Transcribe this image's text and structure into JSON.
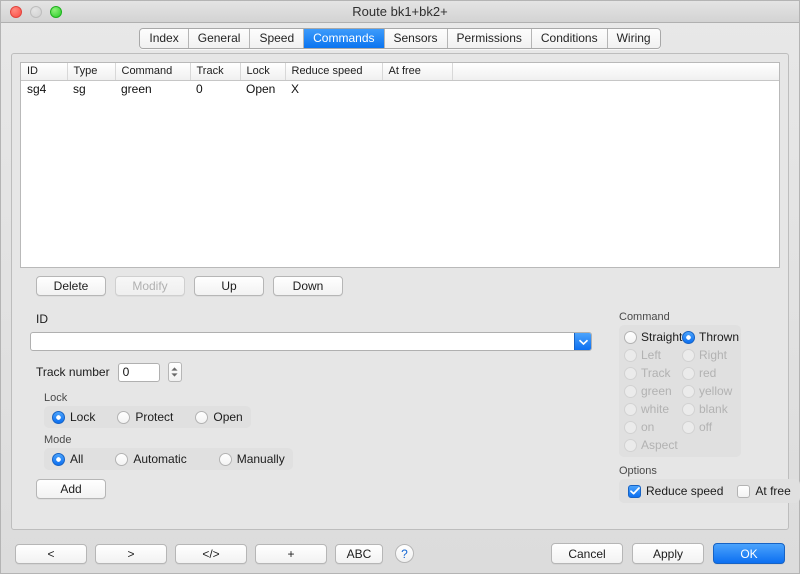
{
  "window": {
    "title": "Route bk1+bk2+",
    "traffic_lights": [
      "close",
      "minimize",
      "zoom"
    ]
  },
  "tabs": [
    {
      "label": "Index",
      "active": false
    },
    {
      "label": "General",
      "active": false
    },
    {
      "label": "Speed",
      "active": false
    },
    {
      "label": "Commands",
      "active": true
    },
    {
      "label": "Sensors",
      "active": false
    },
    {
      "label": "Permissions",
      "active": false
    },
    {
      "label": "Conditions",
      "active": false
    },
    {
      "label": "Wiring",
      "active": false
    }
  ],
  "table": {
    "columns": [
      "ID",
      "Type",
      "Command",
      "Track",
      "Lock",
      "Reduce speed",
      "At free"
    ],
    "rows": [
      [
        "sg4",
        "sg",
        "green",
        "0",
        "Open",
        "X",
        ""
      ]
    ]
  },
  "list_buttons": [
    {
      "label": "Delete",
      "enabled": true
    },
    {
      "label": "Modify",
      "enabled": false
    },
    {
      "label": "Up",
      "enabled": true
    },
    {
      "label": "Down",
      "enabled": true
    }
  ],
  "form": {
    "id_label": "ID",
    "id_value": "",
    "id_placeholder": "",
    "track_label": "Track number",
    "track_value": "0",
    "add_label": "Add",
    "lock": {
      "caption": "Lock",
      "options": [
        {
          "label": "Lock",
          "selected": true
        },
        {
          "label": "Protect",
          "selected": false
        },
        {
          "label": "Open",
          "selected": false
        }
      ]
    },
    "mode": {
      "caption": "Mode",
      "options": [
        {
          "label": "All",
          "selected": true
        },
        {
          "label": "Automatic",
          "selected": false
        },
        {
          "label": "Manually",
          "selected": false
        }
      ]
    }
  },
  "command": {
    "caption": "Command",
    "options": [
      {
        "label": "Straight",
        "selected": false,
        "enabled": true
      },
      {
        "label": "Thrown",
        "selected": true,
        "enabled": true
      },
      {
        "label": "Left",
        "selected": false,
        "enabled": false
      },
      {
        "label": "Right",
        "selected": false,
        "enabled": false
      },
      {
        "label": "Track",
        "selected": false,
        "enabled": false
      },
      {
        "label": "red",
        "selected": false,
        "enabled": false
      },
      {
        "label": "green",
        "selected": false,
        "enabled": false
      },
      {
        "label": "yellow",
        "selected": false,
        "enabled": false
      },
      {
        "label": "white",
        "selected": false,
        "enabled": false
      },
      {
        "label": "blank",
        "selected": false,
        "enabled": false
      },
      {
        "label": "on",
        "selected": false,
        "enabled": false
      },
      {
        "label": "off",
        "selected": false,
        "enabled": false
      },
      {
        "label": "Aspect",
        "selected": false,
        "enabled": false
      }
    ]
  },
  "options": {
    "caption": "Options",
    "items": [
      {
        "label": "Reduce speed",
        "checked": true
      },
      {
        "label": "At free",
        "checked": false
      }
    ]
  },
  "bottom": {
    "nav": [
      {
        "label": "<",
        "name": "previous-button"
      },
      {
        "label": ">",
        "name": "next-button"
      },
      {
        "label": "</>",
        "name": "code-button"
      },
      {
        "label": "+",
        "name": "add-new-button"
      },
      {
        "label": "ABC",
        "name": "abc-button"
      }
    ],
    "help_label": "?",
    "cancel_label": "Cancel",
    "apply_label": "Apply",
    "ok_label": "OK"
  },
  "colors": {
    "accent": "#0c6ff1",
    "window_bg": "#e0e0e0",
    "panel_bg": "#e6e6e6",
    "close": "#fb4b42",
    "zoom": "#27cd26"
  }
}
